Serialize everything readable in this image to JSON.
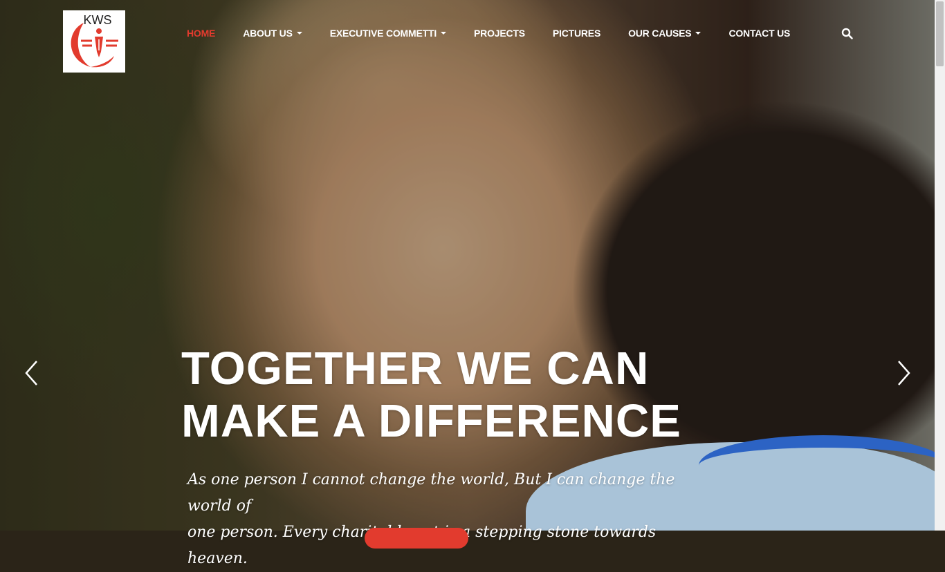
{
  "brand": {
    "logo_text": "KWS",
    "accent_color": "#e23b2e"
  },
  "nav": {
    "items": [
      {
        "label": "HOME",
        "has_dropdown": false,
        "active": true
      },
      {
        "label": "ABOUT US",
        "has_dropdown": true,
        "active": false
      },
      {
        "label": "EXECUTIVE COMMETTI",
        "has_dropdown": true,
        "active": false
      },
      {
        "label": "PROJECTS",
        "has_dropdown": false,
        "active": false
      },
      {
        "label": "PICTURES",
        "has_dropdown": false,
        "active": false
      },
      {
        "label": "OUR CAUSES",
        "has_dropdown": true,
        "active": false
      },
      {
        "label": "CONTACT US",
        "has_dropdown": false,
        "active": false
      }
    ],
    "search_icon": "search-icon"
  },
  "hero": {
    "headline_line1": "TOGETHER WE CAN",
    "headline_line2": "MAKE A DIFFERENCE",
    "subtext_line1": "As one person I cannot change the world, But I can change the world of",
    "subtext_line2": "one person. Every charitable act is a stepping stone towards heaven.",
    "prev_icon": "chevron-left-icon",
    "next_icon": "chevron-right-icon"
  }
}
